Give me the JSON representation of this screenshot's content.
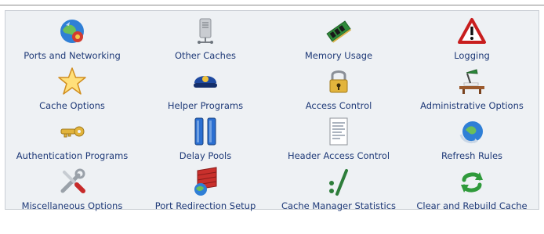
{
  "modules": [
    {
      "label": "Ports and Networking",
      "icon": "globe-network-icon"
    },
    {
      "label": "Other Caches",
      "icon": "server-icon"
    },
    {
      "label": "Memory Usage",
      "icon": "memory-chip-icon"
    },
    {
      "label": "Logging",
      "icon": "warning-icon"
    },
    {
      "label": "Cache Options",
      "icon": "star-icon"
    },
    {
      "label": "Helper Programs",
      "icon": "helper-cap-icon"
    },
    {
      "label": "Access Control",
      "icon": "padlock-icon"
    },
    {
      "label": "Administrative Options",
      "icon": "desk-lamp-icon"
    },
    {
      "label": "Authentication Programs",
      "icon": "key-icon"
    },
    {
      "label": "Delay Pools",
      "icon": "pause-icon"
    },
    {
      "label": "Header Access Control",
      "icon": "document-icon"
    },
    {
      "label": "Refresh Rules",
      "icon": "refresh-globe-icon"
    },
    {
      "label": "Miscellaneous Options",
      "icon": "tools-icon"
    },
    {
      "label": "Port Redirection Setup",
      "icon": "firewall-globe-icon"
    },
    {
      "label": "Cache Manager Statistics",
      "icon": "percent-icon"
    },
    {
      "label": "Clear and Rebuild Cache",
      "icon": "recycle-icon"
    }
  ],
  "colors": {
    "link": "#1f3a78",
    "panel_bg": "#eef1f4",
    "panel_border": "#c9ced4"
  }
}
